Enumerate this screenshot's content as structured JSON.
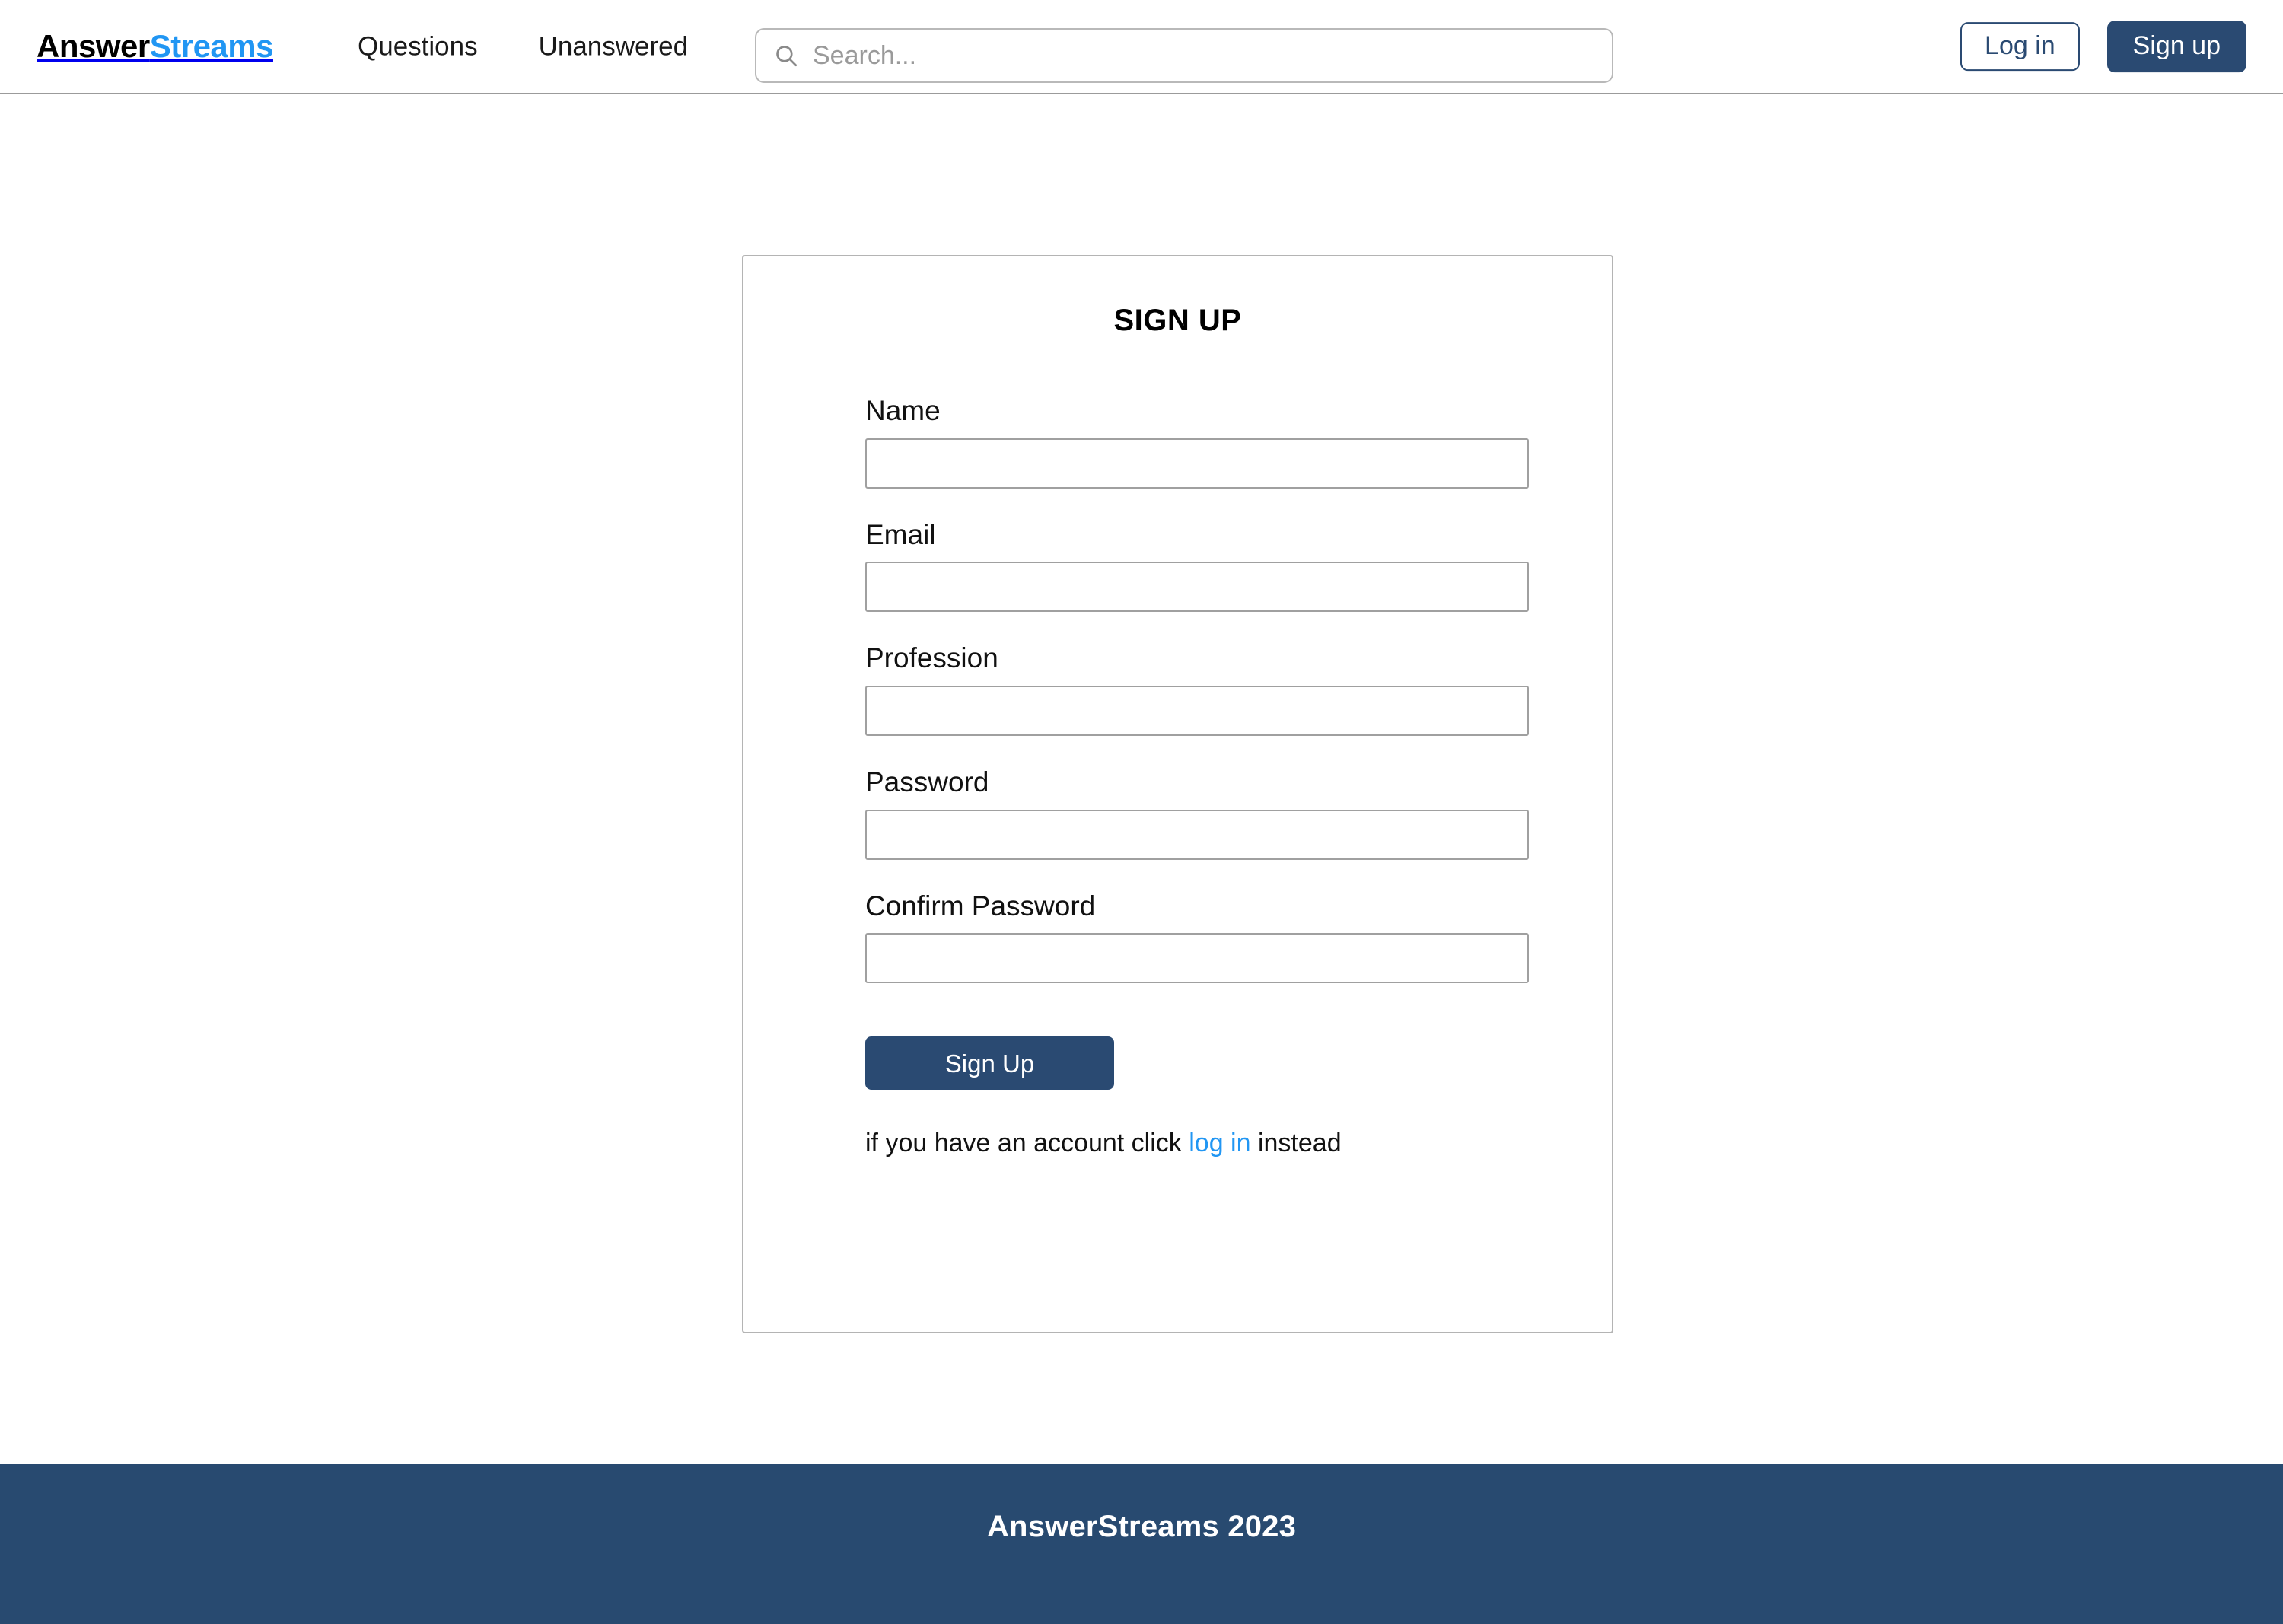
{
  "header": {
    "brand": {
      "part1": "Answer",
      "part2": "Streams",
      "color_part1": "#000000",
      "color_part2": "#2196f3"
    },
    "nav": [
      {
        "label": "Questions"
      },
      {
        "label": "Unanswered"
      }
    ],
    "search": {
      "icon": "search-icon",
      "value": "",
      "placeholder": "Search..."
    },
    "actions": {
      "login_label": "Log in",
      "signup_label": "Sign up"
    }
  },
  "signup_card": {
    "title": "SIGN UP",
    "fields": [
      {
        "label": "Name",
        "value": "",
        "placeholder": "",
        "type": "text",
        "name": "name"
      },
      {
        "label": "Email",
        "value": "",
        "placeholder": "",
        "type": "text",
        "name": "email"
      },
      {
        "label": "Profession",
        "value": "",
        "placeholder": "",
        "type": "text",
        "name": "profession"
      },
      {
        "label": "Password",
        "value": "",
        "placeholder": "",
        "type": "password",
        "name": "password"
      },
      {
        "label": "Confirm Password",
        "value": "",
        "placeholder": "",
        "type": "password",
        "name": "confirm-password"
      }
    ],
    "submit_label": "Sign Up",
    "alt_action": {
      "prefix": "if you have an account click ",
      "link": "log in",
      "suffix": " instead"
    }
  },
  "footer": {
    "text": "AnswerStreams 2023",
    "background": "#284a70"
  },
  "theme": {
    "navy": "#2a4a72",
    "accent_blue": "#2196f3",
    "border_gray": "#b4b4b4",
    "input_border": "#a0a0a0",
    "page_background": "#ffffff"
  }
}
